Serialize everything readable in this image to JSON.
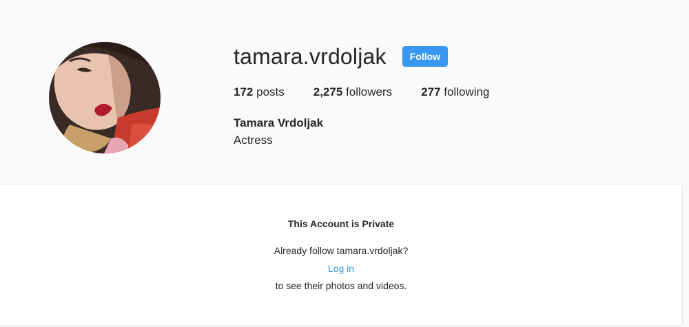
{
  "profile": {
    "username": "tamara.vrdoljak",
    "follow_label": "Follow",
    "full_name": "Tamara Vrdoljak",
    "bio": "Actress",
    "stats": [
      {
        "count": "172",
        "label": "posts"
      },
      {
        "count": "2,275",
        "label": "followers"
      },
      {
        "count": "277",
        "label": "following"
      }
    ]
  },
  "private": {
    "title": "This Account is Private",
    "question": "Already follow tamara.vrdoljak?",
    "login_label": "Log in",
    "subtitle": "to see their photos and videos."
  },
  "colors": {
    "accent": "#3897f0",
    "background": "#fafafa",
    "text": "#262626"
  }
}
